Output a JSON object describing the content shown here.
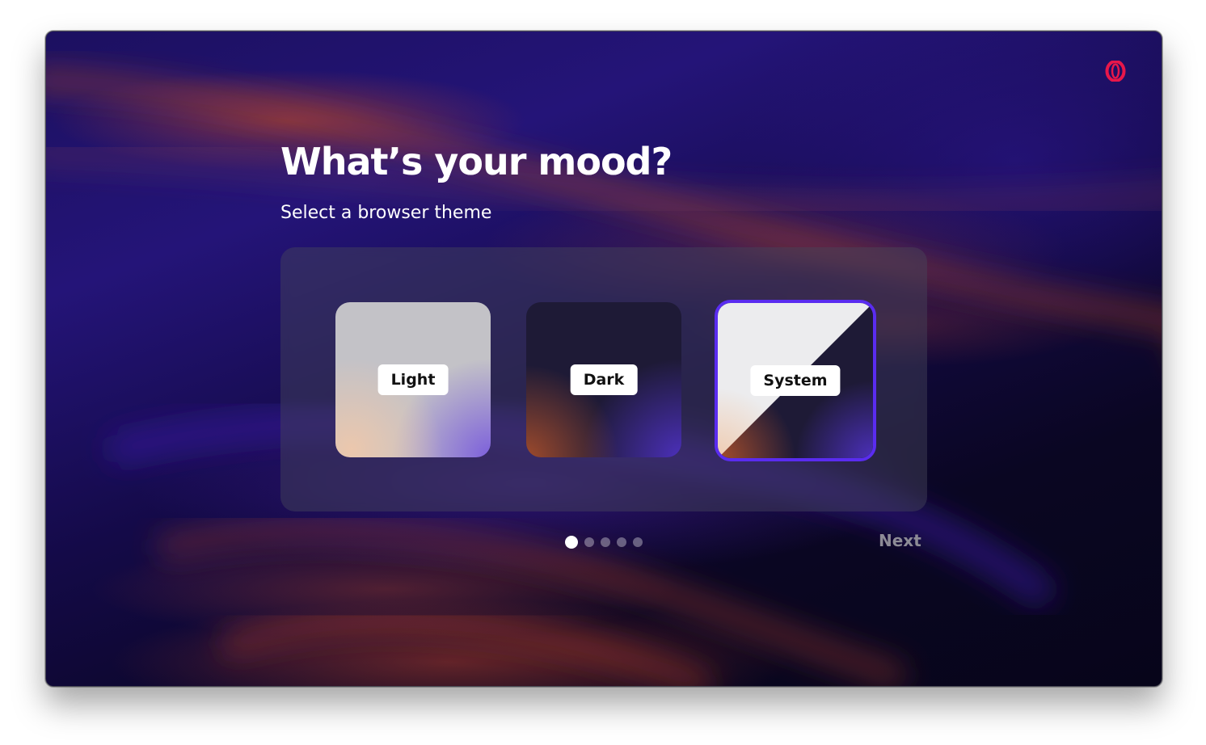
{
  "header": {
    "title": "What’s your mood?",
    "subtitle": "Select a browser theme"
  },
  "themes": [
    {
      "id": "light",
      "label": "Light",
      "selected": false
    },
    {
      "id": "dark",
      "label": "Dark",
      "selected": false
    },
    {
      "id": "system",
      "label": "System",
      "selected": true
    }
  ],
  "pagination": {
    "total": 5,
    "current": 1
  },
  "footer": {
    "next_label": "Next"
  },
  "colors": {
    "logo": "#e8174a",
    "accent": "#5a2cf0",
    "next_text": "#8d8b96"
  },
  "icons": {
    "logo": "opera-logo-icon"
  }
}
